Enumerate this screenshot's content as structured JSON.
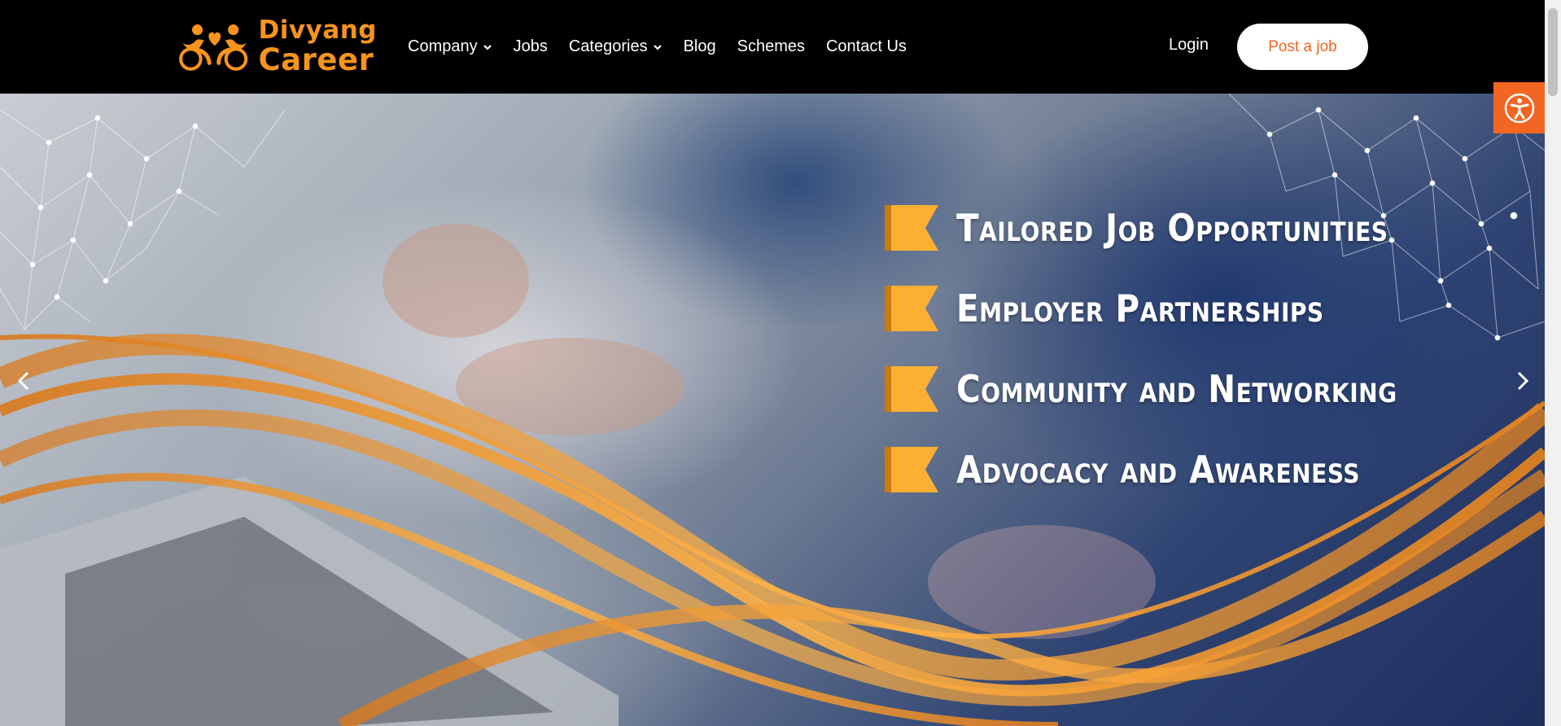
{
  "logo": {
    "line1": "Divyang",
    "line2": "Career",
    "icon": "people-heart-logo-icon",
    "color": "#f7941d"
  },
  "nav": {
    "items": [
      {
        "label": "Company",
        "dropdown": true
      },
      {
        "label": "Jobs",
        "dropdown": false
      },
      {
        "label": "Categories",
        "dropdown": true
      },
      {
        "label": "Blog",
        "dropdown": false
      },
      {
        "label": "Schemes",
        "dropdown": false
      },
      {
        "label": "Contact Us",
        "dropdown": false
      }
    ],
    "login_label": "Login",
    "post_job_label": "Post a job"
  },
  "hero": {
    "features": [
      "Tailored Job Opportunities",
      "Employer Partnerships",
      "Community and Networking",
      "Advocacy and Awareness"
    ],
    "bullet_icon": "orange-flag-icon",
    "prev_icon": "chevron-left-icon",
    "next_icon": "chevron-right-icon"
  },
  "accessibility": {
    "icon": "accessibility-icon",
    "color": "#f26522"
  },
  "colors": {
    "nav_bg": "#000000",
    "accent_orange": "#f26522",
    "flag_orange": "#fbb034",
    "wave_orange": "#f7941d"
  }
}
